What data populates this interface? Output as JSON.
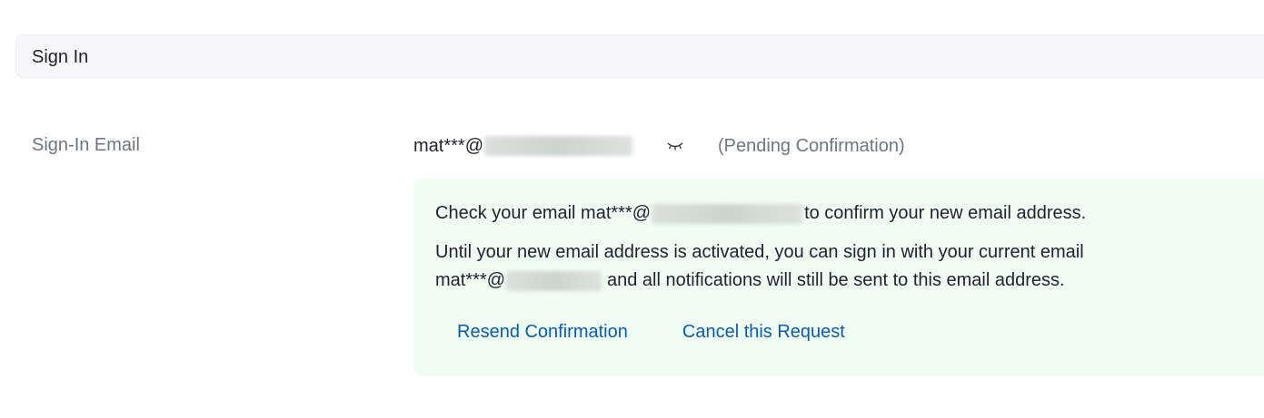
{
  "section": {
    "title": "Sign In"
  },
  "sign_in_email": {
    "label": "Sign-In Email",
    "email_prefix": "mat***@",
    "status": "(Pending Confirmation)",
    "icon": "eye-closed-icon"
  },
  "notice": {
    "line1_before": "Check your email mat***@",
    "line1_after": "to confirm your new email address.",
    "line2": "Until your new email address is activated, you can sign in with your current email",
    "line3_before": "mat***@",
    "line3_after": "and all notifications will still be sent to this email address.",
    "background_color": "#effdf3"
  },
  "actions": {
    "resend_label": "Resend Confirmation",
    "cancel_label": "Cancel this Request",
    "link_color": "#0b5cad"
  }
}
